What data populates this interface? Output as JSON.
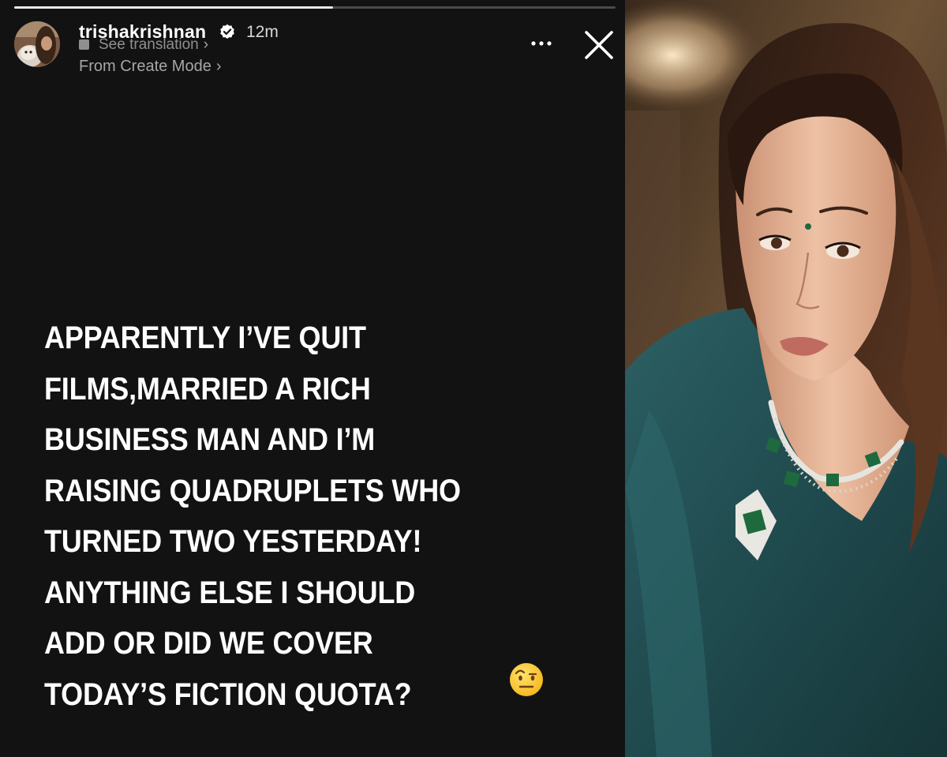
{
  "story": {
    "progress": 0.53,
    "username": "trishakrishnan",
    "verified": true,
    "timestamp": "12m",
    "see_translation": "See translation",
    "from_create_mode": "From Create Mode",
    "more_label": "...",
    "close_label": "×",
    "text_lines": [
      "APPARENTLY I’VE QUIT",
      "FILMS,MARRIED A RICH",
      "BUSINESS MAN AND I’M",
      "RAISING QUADRUPLETS WHO",
      "TURNED TWO YESTERDAY!",
      "ANYTHING ELSE I SHOULD",
      "ADD OR DID WE COVER",
      "TODAY’S FICTION QUOTA?"
    ],
    "emoji_icon": "face-with-raised-eyebrow-icon"
  },
  "colors": {
    "story_background": "#121212",
    "text": "#ffffff",
    "muted_text": "#8f8f8f",
    "progress_fill": "#e9e9e9",
    "progress_track": "#4a4a4a",
    "saree_teal": "#1f4a4e",
    "necklace_emerald": "#1e6a3e"
  }
}
